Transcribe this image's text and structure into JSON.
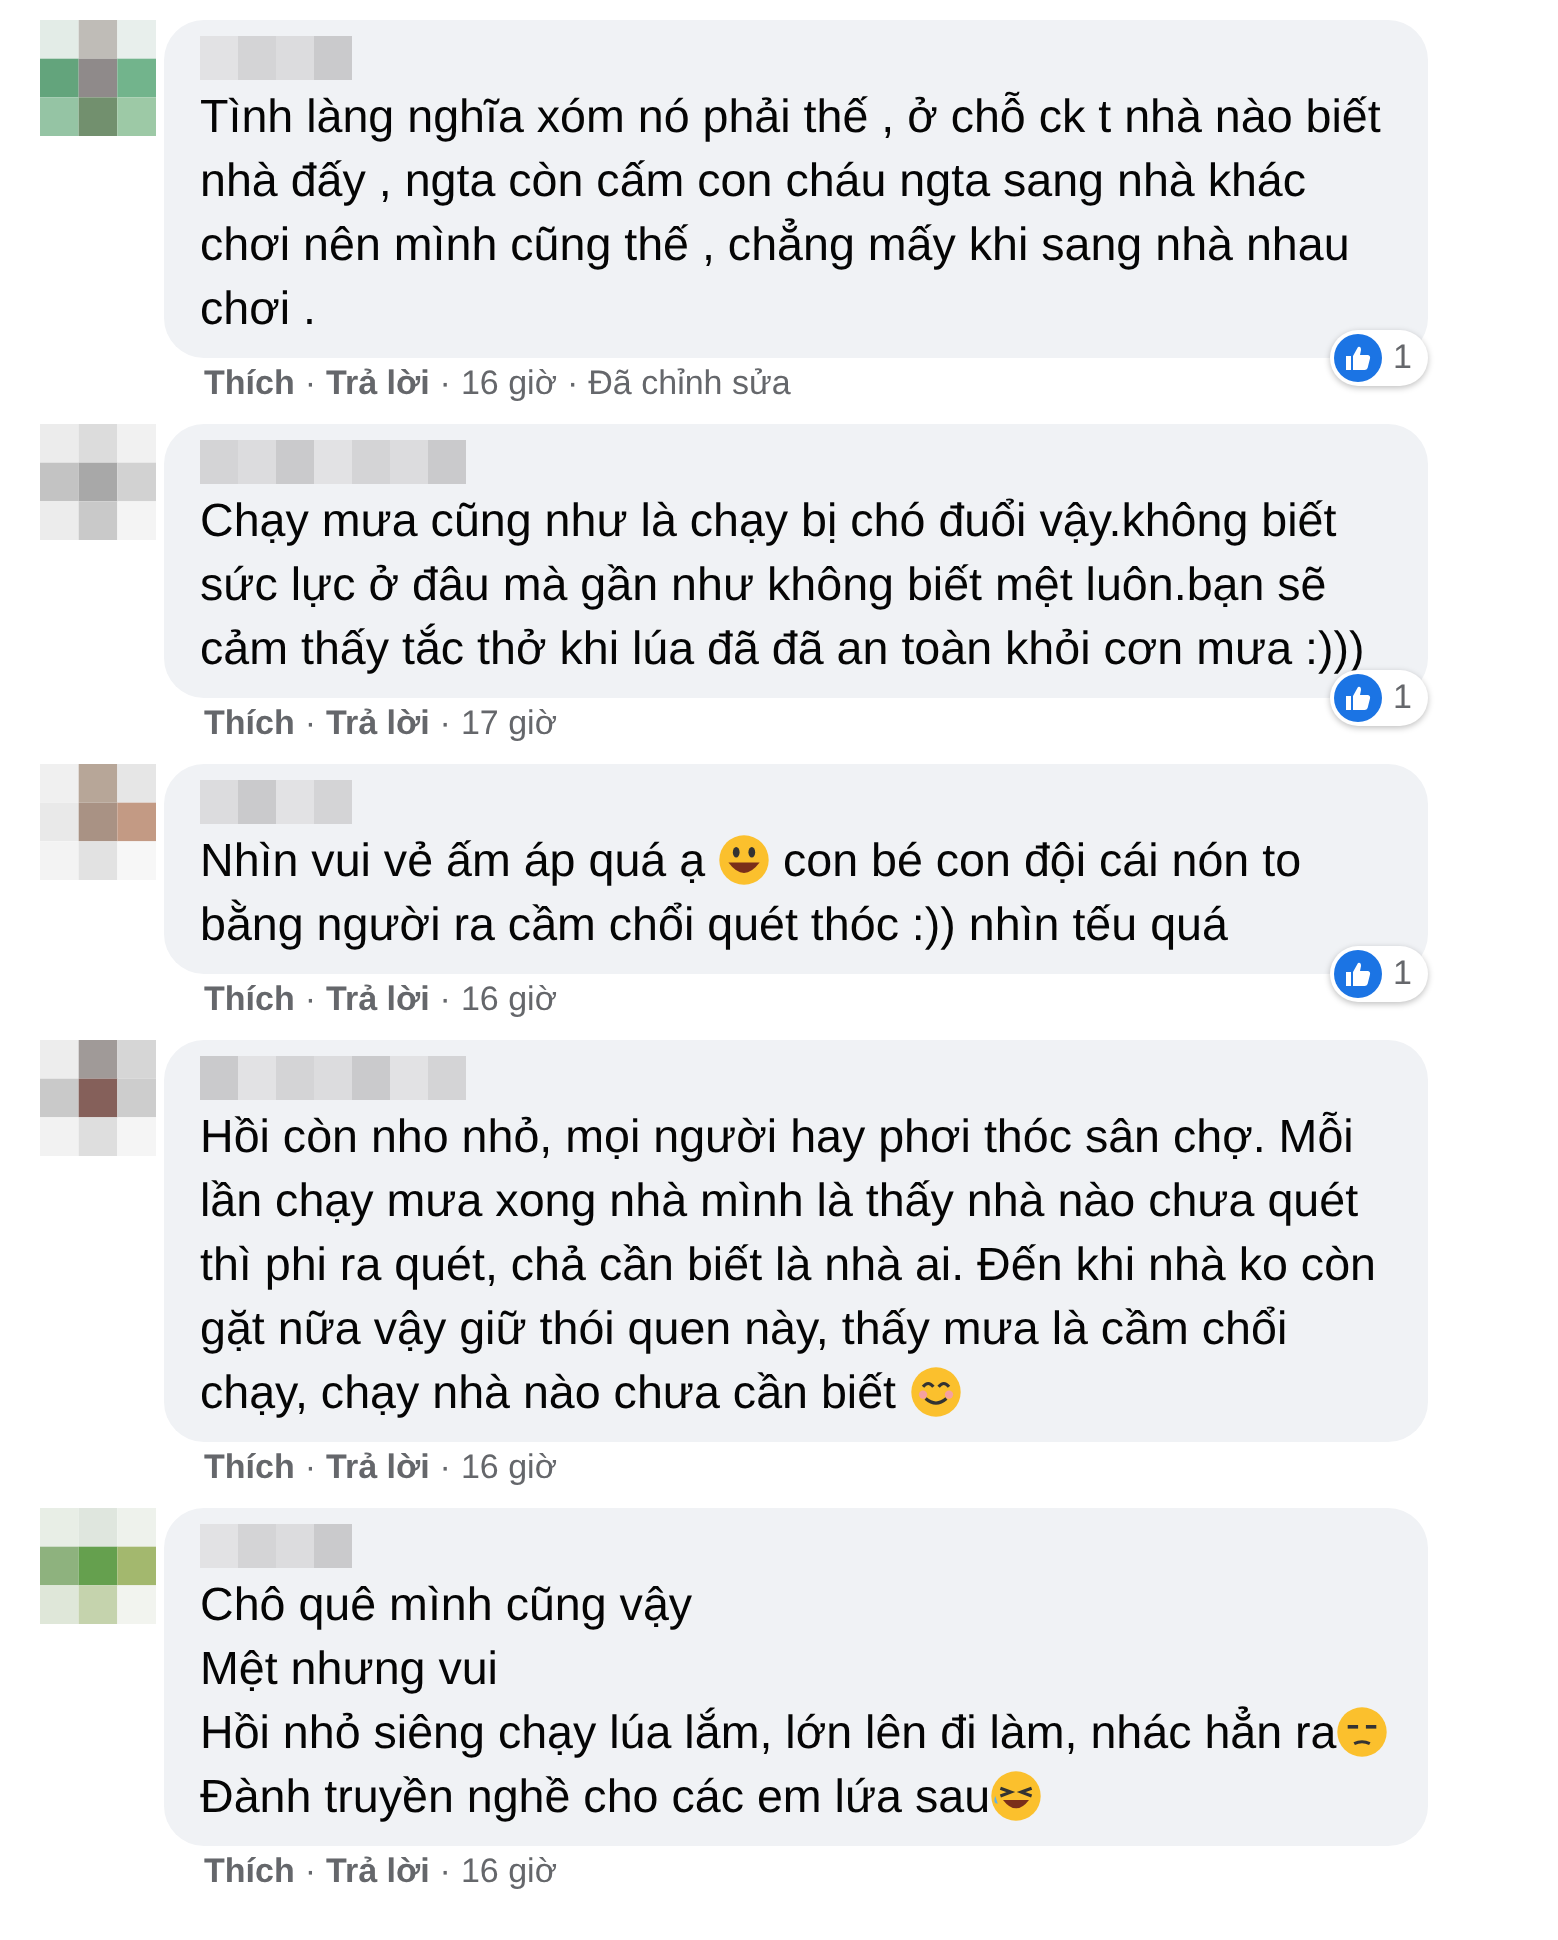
{
  "separator": "·",
  "comments": [
    {
      "lines": [
        [
          {
            "kind": "text",
            "text": "Tình làng nghĩa xóm nó phải thế , ở chỗ ck t nhà nào biết"
          }
        ],
        [
          {
            "kind": "text",
            "text": "nhà đấy , ngta còn cấm con cháu ngta sang nhà khác"
          }
        ],
        [
          {
            "kind": "text",
            "text": "chơi nên mình cũng thế , chẳng mấy khi sang nhà nhau"
          }
        ],
        [
          {
            "kind": "text",
            "text": "chơi ."
          }
        ]
      ],
      "like": "Thích",
      "reply": "Trả lời",
      "time": "16 giờ",
      "edited": "Đã chỉnh sửa",
      "reactions": "1"
    },
    {
      "lines": [
        [
          {
            "kind": "text",
            "text": "Chạy mưa cũng như là chạy bị chó đuổi vậy.không biết"
          }
        ],
        [
          {
            "kind": "text",
            "text": "sức lực ở đâu mà gần như không biết mệt luôn.bạn sẽ"
          }
        ],
        [
          {
            "kind": "text",
            "text": "cảm thấy tắc thở khi lúa đã đã an toàn khỏi cơn mưa :)))"
          }
        ]
      ],
      "like": "Thích",
      "reply": "Trả lời",
      "time": "17 giờ",
      "reactions": "1"
    },
    {
      "lines": [
        [
          {
            "kind": "text",
            "text": "Nhìn vui vẻ ấm áp quá ạ "
          },
          {
            "kind": "emoji"
          },
          {
            "kind": "text",
            "text": " con bé con đội cái nón to"
          }
        ],
        [
          {
            "kind": "text",
            "text": "bằng người ra cầm chổi quét thóc :)) nhìn tếu quá"
          }
        ]
      ],
      "like": "Thích",
      "reply": "Trả lời",
      "time": "16 giờ",
      "reactions": "1"
    },
    {
      "lines": [
        [
          {
            "kind": "text",
            "text": "Hồi còn nho nhỏ, mọi người hay phơi thóc sân chợ. Mỗi"
          }
        ],
        [
          {
            "kind": "text",
            "text": "lần chạy mưa xong nhà mình là thấy nhà nào chưa quét"
          }
        ],
        [
          {
            "kind": "text",
            "text": "thì phi ra quét, chả cần biết là nhà ai. Đến khi nhà ko còn"
          }
        ],
        [
          {
            "kind": "text",
            "text": "gặt nữa vậy giữ thói quen này, thấy mưa là cầm chổi"
          }
        ],
        [
          {
            "kind": "text",
            "text": "chạy, chạy nhà nào chưa cần biết "
          },
          {
            "kind": "emoji"
          }
        ]
      ],
      "like": "Thích",
      "reply": "Trả lời",
      "time": "16 giờ"
    },
    {
      "lines": [
        [
          {
            "kind": "text",
            "text": "Chô quê mình cũng vậy"
          }
        ],
        [
          {
            "kind": "text",
            "text": "Mệt nhưng vui"
          }
        ],
        [
          {
            "kind": "text",
            "text": "Hồi nhỏ siêng chạy lúa lắm, lớn lên đi làm, nhác hẳn ra"
          },
          {
            "kind": "emoji"
          }
        ],
        [
          {
            "kind": "text",
            "text": "Đành truyền nghề cho các em lứa sau"
          },
          {
            "kind": "emoji"
          }
        ]
      ],
      "like": "Thích",
      "reply": "Trả lời",
      "time": "16 giờ"
    }
  ]
}
